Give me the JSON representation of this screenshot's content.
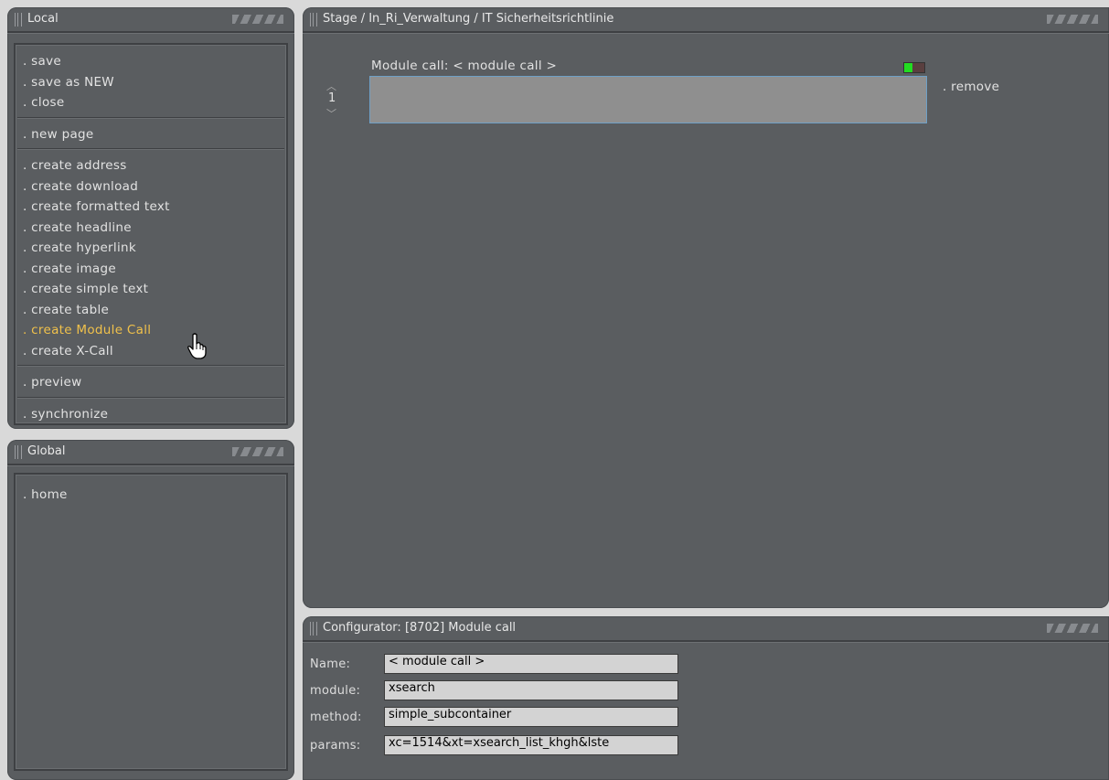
{
  "local_panel": {
    "title": "Local",
    "menu": [
      {
        "label": ". save"
      },
      {
        "label": ". save as NEW"
      },
      {
        "label": ". close"
      },
      {
        "label": ". new page"
      },
      {
        "label": ". create address"
      },
      {
        "label": ". create download"
      },
      {
        "label": ". create formatted text"
      },
      {
        "label": ". create headline"
      },
      {
        "label": ". create hyperlink"
      },
      {
        "label": ". create image"
      },
      {
        "label": ". create simple text"
      },
      {
        "label": ". create table"
      },
      {
        "label": ". create Module Call"
      },
      {
        "label": ". create X-Call"
      },
      {
        "label": ". preview"
      },
      {
        "label": ". synchronize"
      }
    ]
  },
  "global_panel": {
    "title": "Global",
    "menu": [
      {
        "label": ". home"
      }
    ]
  },
  "stage": {
    "breadcrumb": "Stage / In_Ri_Verwaltung / IT Sicherheitsrichtlinie",
    "module_label": "Module call: < module call >",
    "order_number": "1",
    "remove_label": ". remove",
    "status_color": "#22dd22"
  },
  "configurator": {
    "title": "Configurator: [8702] Module call",
    "fields": {
      "name": {
        "label": "Name:",
        "value": "< module call >"
      },
      "module": {
        "label": "module:",
        "value": "xsearch"
      },
      "method": {
        "label": "method:",
        "value": "simple_subcontainer"
      },
      "params": {
        "label": "params:",
        "value": "xc=1514&xt=xsearch_list_khgh&lste"
      }
    }
  },
  "colors": {
    "panel_bg": "#5a5d60",
    "accent_active": "#f0c14b",
    "input_bg": "#d3d3d3"
  }
}
